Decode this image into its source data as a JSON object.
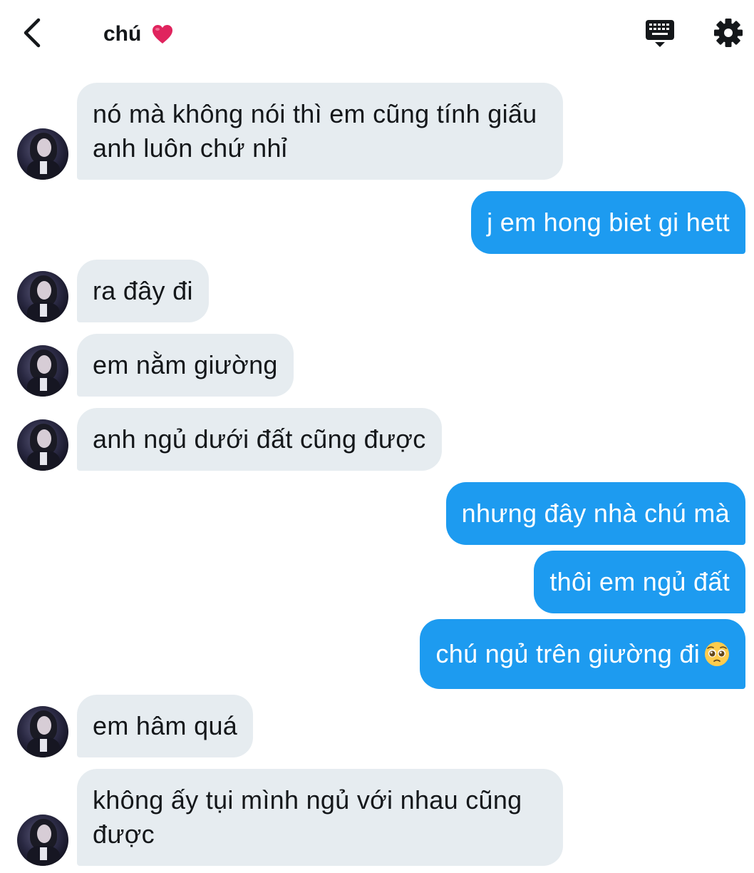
{
  "header": {
    "title": "chú",
    "back_icon": "chevron-left-icon",
    "heart_icon": "red-heart-emoji-icon",
    "keyboard_icon": "keyboard-icon",
    "settings_icon": "gear-icon"
  },
  "colors": {
    "incoming_bubble": "#e6ecf0",
    "outgoing_bubble": "#1d9bf0",
    "heart": "#e0245e"
  },
  "messages": [
    {
      "side": "incoming",
      "text": "nó mà không nói thì em cũng tính giấu anh luôn chứ nhỉ"
    },
    {
      "side": "outgoing",
      "text": "j em hong biet gi hett"
    },
    {
      "side": "incoming",
      "text": "ra đây đi"
    },
    {
      "side": "incoming",
      "text": "em nằm giường"
    },
    {
      "side": "incoming",
      "text": "anh ngủ dưới đất cũng được"
    },
    {
      "side": "outgoing",
      "text": "nhưng đây nhà chú mà"
    },
    {
      "side": "outgoing",
      "text": "thôi em ngủ đất"
    },
    {
      "side": "outgoing",
      "text": "chú ngủ trên giường đi",
      "emoji": "pleading-face-emoji-icon"
    },
    {
      "side": "incoming",
      "text": "em hâm quá"
    },
    {
      "side": "incoming",
      "text": "không ấy tụi mình ngủ với nhau cũng được"
    }
  ]
}
